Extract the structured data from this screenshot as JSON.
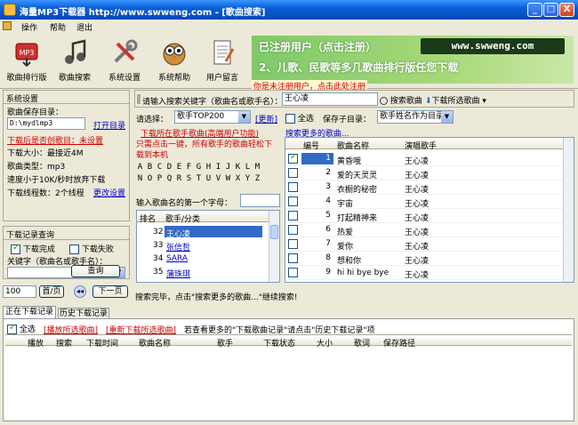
{
  "window": {
    "title": "海量MP3下载器  http://www.swweng.com - [歌曲搜索]",
    "buttons": [
      "_",
      "□",
      "X"
    ]
  },
  "menu": [
    "操作",
    "帮助",
    "退出"
  ],
  "toolbar": [
    {
      "label": "歌曲排行版",
      "icon": "download-icon"
    },
    {
      "label": "歌曲搜索",
      "icon": "music-notes-icon"
    },
    {
      "label": "系统设置",
      "icon": "tools-icon"
    },
    {
      "label": "系统帮助",
      "icon": "help-owl-icon"
    },
    {
      "label": "用户留言",
      "icon": "notepad-icon"
    }
  ],
  "banner": {
    "line1": "已注册用户（点击注册）",
    "line2": "2、儿歌、民歌等多几歌曲排行版任您下载",
    "url": "www.swweng.com"
  },
  "notice": "你是未注册用户，点击此处注册",
  "settings": {
    "header": "系统设置",
    "save_dir_label": "歌曲保存目录：",
    "save_dir_value": "D:\\mydlmp3",
    "open_dir": "打开目录",
    "auto_create": "下载后是否创歌目：未设置",
    "size": "下载大小：最接近4M",
    "type": "歌曲类型：mp3",
    "speed": "速度小于10K/秒时放弃下载",
    "threads": "下载线程数：2个线程",
    "modify": "更改设置"
  },
  "query": {
    "header": "下载记录查询",
    "done": "下载完成",
    "failed": "下载失败",
    "keyword_label": "关键字（歌曲名或歌手名）：",
    "search_btn": "查询"
  },
  "search": {
    "label": "请输入搜索关键字（歌曲名或歌手名）：",
    "value": "王心凌",
    "search_btn": "搜索歌曲",
    "download_btn": "下载所选歌曲"
  },
  "selector": {
    "label": "请选择：",
    "value": "歌手TOP200",
    "update": "[更新]",
    "select_all": "全选",
    "save_dir_label": "保存子目录：",
    "save_dir_value": "歌手姓名作为目录"
  },
  "promo": {
    "title": "下载所在歌手歌曲(高端用户功能)",
    "desc1": "只需点击一键，所有歌手的歌曲轻松下",
    "desc2": "载到本机"
  },
  "more_songs": "搜索更多的歌曲...",
  "letters": {
    "row1": [
      "A",
      "B",
      "C",
      "D",
      "E",
      "F",
      "G",
      "H",
      "I",
      "J",
      "K",
      "L",
      "M"
    ],
    "row2": [
      "N",
      "O",
      "P",
      "Q",
      "R",
      "S",
      "T",
      "U",
      "V",
      "W",
      "X",
      "Y",
      "Z"
    ]
  },
  "initial_label": "输入歌曲名的第一个字母：",
  "singers": {
    "columns": [
      "排名",
      "歌手/分类"
    ],
    "rows": [
      {
        "rank": "32",
        "name": "王心凌"
      },
      {
        "rank": "33",
        "name": "张信哲"
      },
      {
        "rank": "34",
        "name": "SARA"
      },
      {
        "rank": "35",
        "name": "蒲珠琪"
      }
    ]
  },
  "songs": {
    "columns": [
      "编号",
      "歌曲名称",
      "演唱歌手"
    ],
    "rows": [
      {
        "no": "1",
        "title": "黄昏哦",
        "singer": "王心凌",
        "checked": true
      },
      {
        "no": "2",
        "title": "爱的天灵灵",
        "singer": "王心凌",
        "checked": false
      },
      {
        "no": "3",
        "title": "衣橱的秘密",
        "singer": "王心凌",
        "checked": false
      },
      {
        "no": "4",
        "title": "宇宙",
        "singer": "王心凌",
        "checked": false
      },
      {
        "no": "5",
        "title": "打起精神来",
        "singer": "王心凌",
        "checked": false
      },
      {
        "no": "6",
        "title": "热爱",
        "singer": "王心凌",
        "checked": false
      },
      {
        "no": "7",
        "title": "爱你",
        "singer": "王心凌",
        "checked": false
      },
      {
        "no": "8",
        "title": "想和你",
        "singer": "王心凌",
        "checked": false
      },
      {
        "no": "9",
        "title": "hi hi bye bye",
        "singer": "王心凌",
        "checked": false
      }
    ]
  },
  "pager": {
    "page_value": "100",
    "page_label": "首/页",
    "next": "下一页"
  },
  "status": "搜索完毕，点击\"搜索更多的歌曲...\"继续搜索!",
  "bottom_tabs": [
    "正在下载记录",
    "历史下载记录"
  ],
  "bottom_bar": {
    "select_all": "全选",
    "play": "[播放所选歌曲]",
    "redownload": "[重新下载所选歌曲]",
    "hint": "若查看更多的\"下载歌曲记录\"请点击\"历史下载记录\"项"
  },
  "download_columns": [
    "播放",
    "搜索",
    "下载时间",
    "歌曲名称",
    "歌手",
    "下载状态",
    "大小",
    "歌词",
    "保存路径"
  ],
  "colors": {
    "title_bar": "#0a5fd8",
    "selected": "#316ac5",
    "red_text": "#cc0000",
    "link": "#0000cc"
  }
}
